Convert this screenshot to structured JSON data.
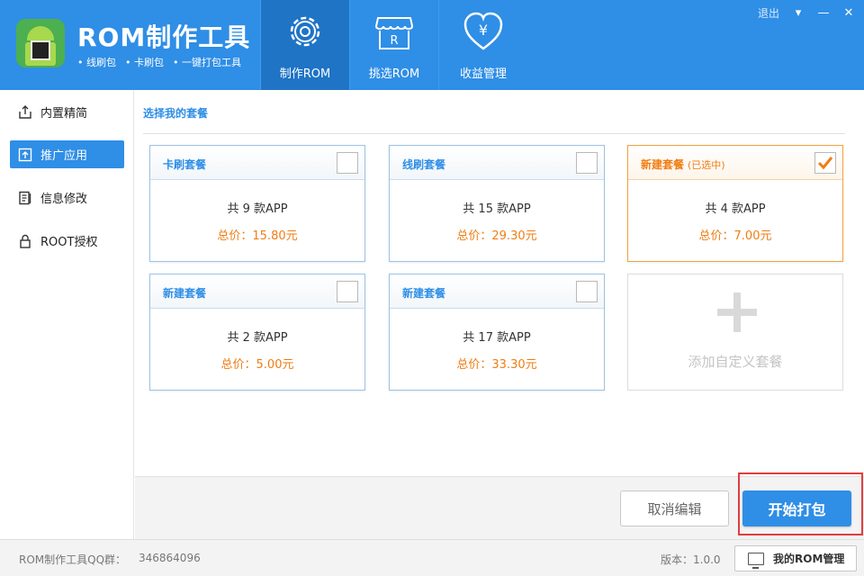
{
  "header": {
    "title": "ROM制作工具",
    "subtitles": [
      "线刷包",
      "卡刷包",
      "一键打包工具"
    ],
    "nav": [
      {
        "label": "制作ROM",
        "icon": "gear-icon",
        "active": true
      },
      {
        "label": "挑选ROM",
        "icon": "shop-icon",
        "active": false
      },
      {
        "label": "收益管理",
        "icon": "heart-yen-icon",
        "active": false
      }
    ],
    "logout": "退出"
  },
  "sidebar": {
    "items": [
      {
        "label": "内置精简",
        "icon": "export-icon",
        "active": false
      },
      {
        "label": "推广应用",
        "icon": "promote-icon",
        "active": true
      },
      {
        "label": "信息修改",
        "icon": "document-icon",
        "active": false
      },
      {
        "label": "ROOT授权",
        "icon": "lock-icon",
        "active": false
      }
    ]
  },
  "main": {
    "section_title": "选择我的套餐",
    "packages": [
      {
        "name": "卡刷套餐",
        "tag": "",
        "count": "共 9 款APP",
        "price": "总价：15.80元",
        "selected": false
      },
      {
        "name": "线刷套餐",
        "tag": "",
        "count": "共 15 款APP",
        "price": "总价：29.30元",
        "selected": false
      },
      {
        "name": "新建套餐",
        "tag": "(已选中)",
        "count": "共 4 款APP",
        "price": "总价：7.00元",
        "selected": true
      },
      {
        "name": "新建套餐",
        "tag": "",
        "count": "共 2 款APP",
        "price": "总价：5.00元",
        "selected": false
      },
      {
        "name": "新建套餐",
        "tag": "",
        "count": "共 17 款APP",
        "price": "总价：33.30元",
        "selected": false
      }
    ],
    "add_label": "添加自定义套餐"
  },
  "actions": {
    "cancel_label": "取消编辑",
    "start_label": "开始打包"
  },
  "footer": {
    "qq_label": "ROM制作工具QQ群：",
    "qq_number": "346864096",
    "version": "版本：1.0.0",
    "manage_label": "我的ROM管理"
  },
  "colors": {
    "primary": "#2f8ee6",
    "accent": "#f07d13",
    "highlight_frame": "#e13d3d"
  }
}
